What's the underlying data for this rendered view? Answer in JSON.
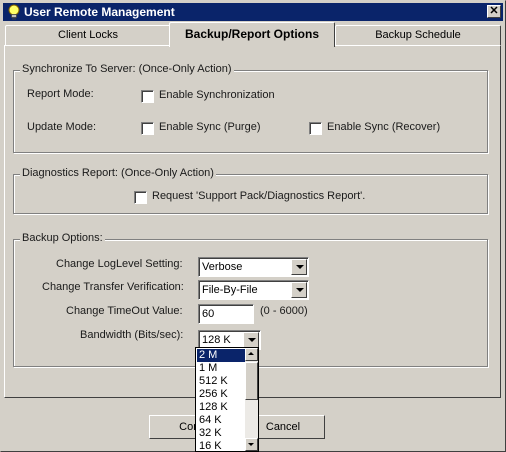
{
  "window": {
    "title": "User Remote Management",
    "close_glyph": "✕",
    "icon": "lightbulb-icon"
  },
  "tabs": [
    {
      "label": "Client Locks",
      "active": false
    },
    {
      "label": "Backup/Report Options",
      "active": true
    },
    {
      "label": "Backup Schedule",
      "active": false
    }
  ],
  "sync_group": {
    "title": "Synchronize To Server: (Once-Only Action)",
    "report_mode_label": "Report Mode:",
    "update_mode_label": "Update Mode:",
    "enable_sync_label": "Enable Synchronization",
    "enable_sync_checked": false,
    "purge_label": "Enable Sync (Purge)",
    "purge_checked": false,
    "recover_label": "Enable Sync (Recover)",
    "recover_checked": false
  },
  "diagnostics_group": {
    "title": "Diagnostics Report: (Once-Only Action)",
    "request_label": "Request 'Support Pack/Diagnostics Report'.",
    "request_checked": false
  },
  "backup_group": {
    "title": "Backup Options:",
    "loglevel_label": "Change LogLevel Setting:",
    "loglevel_value": "Verbose",
    "transfer_label": "Change Transfer Verification:",
    "transfer_value": "File-By-File",
    "timeout_label": "Change TimeOut Value:",
    "timeout_value": "60",
    "timeout_range": "(0 - 6000)",
    "bandwidth_label": "Bandwidth (Bits/sec):",
    "bandwidth_value": "128 K"
  },
  "bandwidth_dropdown": {
    "options": [
      "2 M",
      "1 M",
      "512 K",
      "256 K",
      "128 K",
      "64 K",
      "32 K",
      "16 K"
    ],
    "highlighted": "2 M"
  },
  "buttons": {
    "confirm_label": "Confi",
    "cancel_label": "Cancel"
  },
  "colors": {
    "titlebar": "#0a246a",
    "face": "#d4d0c8",
    "selection": "#0a246a"
  }
}
